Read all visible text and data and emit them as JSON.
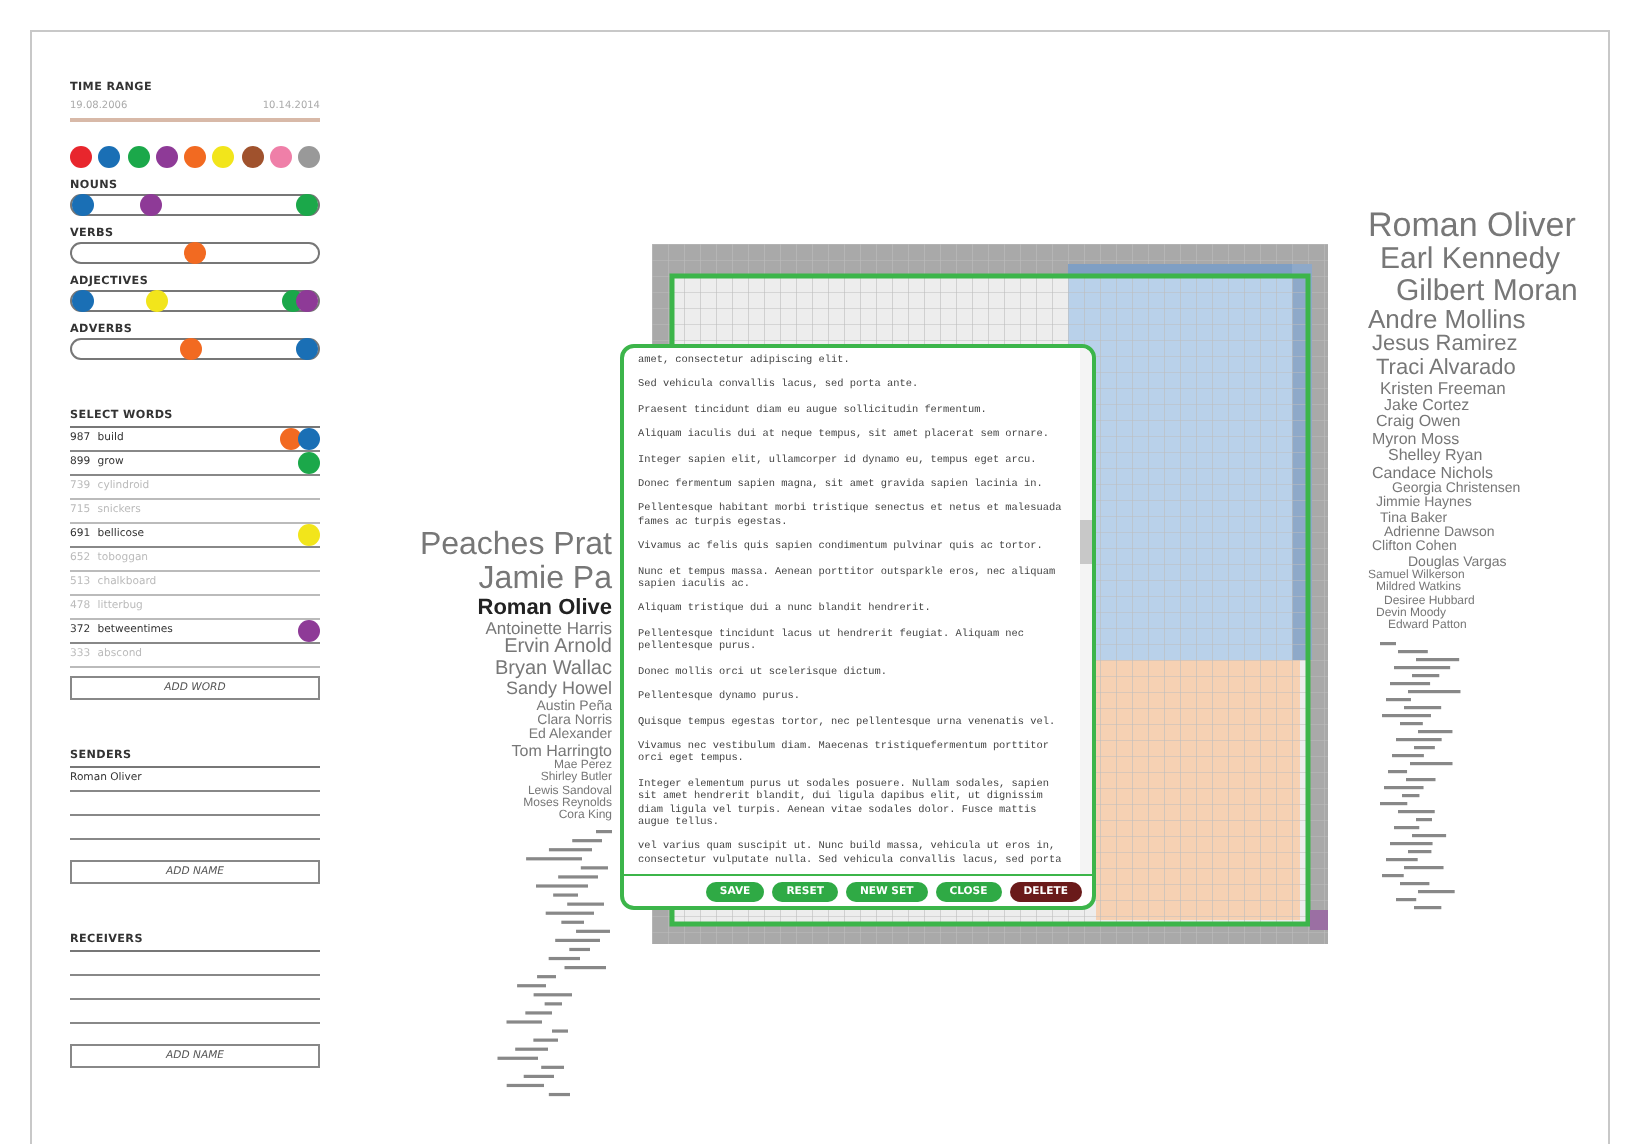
{
  "time_range": {
    "title": "TIME RANGE",
    "start": "19.08.2006",
    "end": "10.14.2014"
  },
  "palette": [
    {
      "color": "#e8262d"
    },
    {
      "color": "#1a6fb5"
    },
    {
      "color": "#1ba84a"
    },
    {
      "color": "#8e3a97"
    },
    {
      "color": "#f26a21"
    },
    {
      "color": "#f2e51b"
    },
    {
      "color": "#a0522d"
    },
    {
      "color": "#ef7fa8"
    },
    {
      "color": "#999999"
    }
  ],
  "categories": [
    {
      "label": "NOUNS",
      "dots": [
        {
          "color": "#1a6fb5",
          "level": 0
        },
        {
          "color": "#8e3a97",
          "level": 0.3
        },
        {
          "color": "#1ba84a",
          "level": 1
        }
      ]
    },
    {
      "label": "VERBS",
      "dots": [
        {
          "color": "#f26a21",
          "level": 0.5
        }
      ]
    },
    {
      "label": "ADJECTIVES",
      "dots": [
        {
          "color": "#1a6fb5",
          "level": 0
        },
        {
          "color": "#f2e51b",
          "level": 0.33
        },
        {
          "color": "#1ba84a",
          "level": 0.94
        },
        {
          "color": "#8e3a97",
          "level": 1
        }
      ]
    },
    {
      "label": "ADVERBS",
      "dots": [
        {
          "color": "#f26a21",
          "level": 0.48
        },
        {
          "color": "#1a6fb5",
          "level": 1
        }
      ]
    }
  ],
  "select_words": {
    "title": "SELECT WORDS",
    "rows": [
      {
        "count": "987",
        "word": "build",
        "disabled": false,
        "dots": [
          {
            "color": "#f26a21"
          },
          {
            "color": "#1a6fb5"
          }
        ]
      },
      {
        "count": "899",
        "word": "grow",
        "disabled": false,
        "dots": [
          {
            "color": "#1ba84a"
          }
        ]
      },
      {
        "count": "739",
        "word": "cylindroid",
        "disabled": true
      },
      {
        "count": "715",
        "word": "snickers",
        "disabled": true
      },
      {
        "count": "691",
        "word": "bellicose",
        "disabled": false,
        "dots": [
          {
            "color": "#f2e51b"
          }
        ]
      },
      {
        "count": "652",
        "word": "toboggan",
        "disabled": true
      },
      {
        "count": "513",
        "word": "chalkboard",
        "disabled": true
      },
      {
        "count": "478",
        "word": "litterbug",
        "disabled": true
      },
      {
        "count": "372",
        "word": "betweentimes",
        "disabled": false,
        "dots": [
          {
            "color": "#8e3a97"
          }
        ]
      },
      {
        "count": "333",
        "word": "abscond",
        "disabled": true
      }
    ],
    "button": "ADD WORD"
  },
  "senders": {
    "title": "SENDERS",
    "names": [
      "Roman Oliver"
    ],
    "button": "ADD NAME"
  },
  "receivers": {
    "title": "RECEIVERS",
    "button": "ADD NAME"
  },
  "left_cloud": [
    {
      "name": "Peaches Prat",
      "highlighted": false
    },
    {
      "name": "Jamie Pa",
      "highlighted": false
    },
    {
      "name": "Roman Olive",
      "highlighted": true
    },
    {
      "name": "Antoinette Harris",
      "highlighted": false
    },
    {
      "name": "Ervin Arnold",
      "highlighted": false
    },
    {
      "name": "Bryan Wallac",
      "highlighted": false
    },
    {
      "name": "Sandy Howel",
      "highlighted": false
    },
    {
      "name": "Austin Peña",
      "highlighted": false
    },
    {
      "name": "Clara Norris",
      "highlighted": false
    },
    {
      "name": "Ed Alexander",
      "highlighted": false
    },
    {
      "name": "Tom Harringto",
      "highlighted": false
    },
    {
      "name": "Mae Perez",
      "highlighted": false
    },
    {
      "name": "Shirley Butler",
      "highlighted": false
    },
    {
      "name": "Lewis Sandoval",
      "highlighted": false
    },
    {
      "name": "Moses Reynolds",
      "highlighted": false
    },
    {
      "name": "Cora King",
      "highlighted": false
    }
  ],
  "dialog": {
    "paragraphs": [
      "amet, consectetur adipiscing elit.",
      "Sed vehicula convallis lacus, sed porta ante.",
      "Praesent tincidunt diam eu augue sollicitudin fermentum.",
      "Aliquam iaculis dui at neque tempus, sit amet placerat sem ornare.",
      "Integer sapien elit, ullamcorper id dynamo eu, tempus eget arcu.",
      "Donec fermentum sapien magna, sit amet gravida sapien lacinia in.",
      "Pellentesque habitant morbi tristique senectus et netus et malesuada fames ac turpis egestas.",
      "Vivamus ac felis quis sapien condimentum pulvinar quis ac tortor.",
      "Nunc et tempus massa. Aenean porttitor outsparkle eros, nec aliquam sapien iaculis ac.",
      "Aliquam tristique dui a nunc blandit hendrerit.",
      "Pellentesque tincidunt lacus ut hendrerit feugiat. Aliquam nec pellentesque purus.",
      "Donec mollis orci ut scelerisque dictum.",
      "Pellentesque dynamo purus.",
      "Quisque tempus egestas tortor, nec pellentesque urna venenatis vel.",
      "Vivamus nec vestibulum diam. Maecenas tristiquefermentum porttitor orci eget tempus.",
      "Integer elementum purus ut sodales posuere. Nullam sodales, sapien sit amet hendrerit blandit, dui ligula dapibus elit, ut dignissim diam ligula vel turpis. Aenean vitae sodales dolor. Fusce mattis augue tellus.",
      "vel varius quam suscipit ut. Nunc build massa, vehicula ut eros in, consectetur vulputate nulla. Sed vehicula convallis lacus, sed porta"
    ],
    "buttons": [
      {
        "label": "SAVE",
        "kind": "action"
      },
      {
        "label": "RESET",
        "kind": "action"
      },
      {
        "label": "NEW SET",
        "kind": "action"
      },
      {
        "label": "CLOSE",
        "kind": "action"
      },
      {
        "label": "DELETE",
        "kind": "danger"
      }
    ]
  },
  "right_cloud": [
    {
      "name": "Roman Oliver"
    },
    {
      "name": "Earl Kennedy"
    },
    {
      "name": "Gilbert Moran"
    },
    {
      "name": "Andre Mollins"
    },
    {
      "name": "Jesus Ramirez"
    },
    {
      "name": "Traci Alvarado"
    },
    {
      "name": "Kristen Freeman"
    },
    {
      "name": "Jake Cortez"
    },
    {
      "name": "Craig Owen"
    },
    {
      "name": "Myron Moss"
    },
    {
      "name": "Shelley Ryan"
    },
    {
      "name": "Candace Nichols"
    },
    {
      "name": "Georgia Christensen"
    },
    {
      "name": "Jimmie Haynes"
    },
    {
      "name": "Tina Baker"
    },
    {
      "name": "Adrienne Dawson"
    },
    {
      "name": "Clifton Cohen"
    },
    {
      "name": "Douglas Vargas"
    },
    {
      "name": "Samuel Wilkerson"
    },
    {
      "name": "Mildred Watkins"
    },
    {
      "name": "Desiree Hubbard"
    },
    {
      "name": "Devin Moody"
    },
    {
      "name": "Edward Patton"
    }
  ]
}
